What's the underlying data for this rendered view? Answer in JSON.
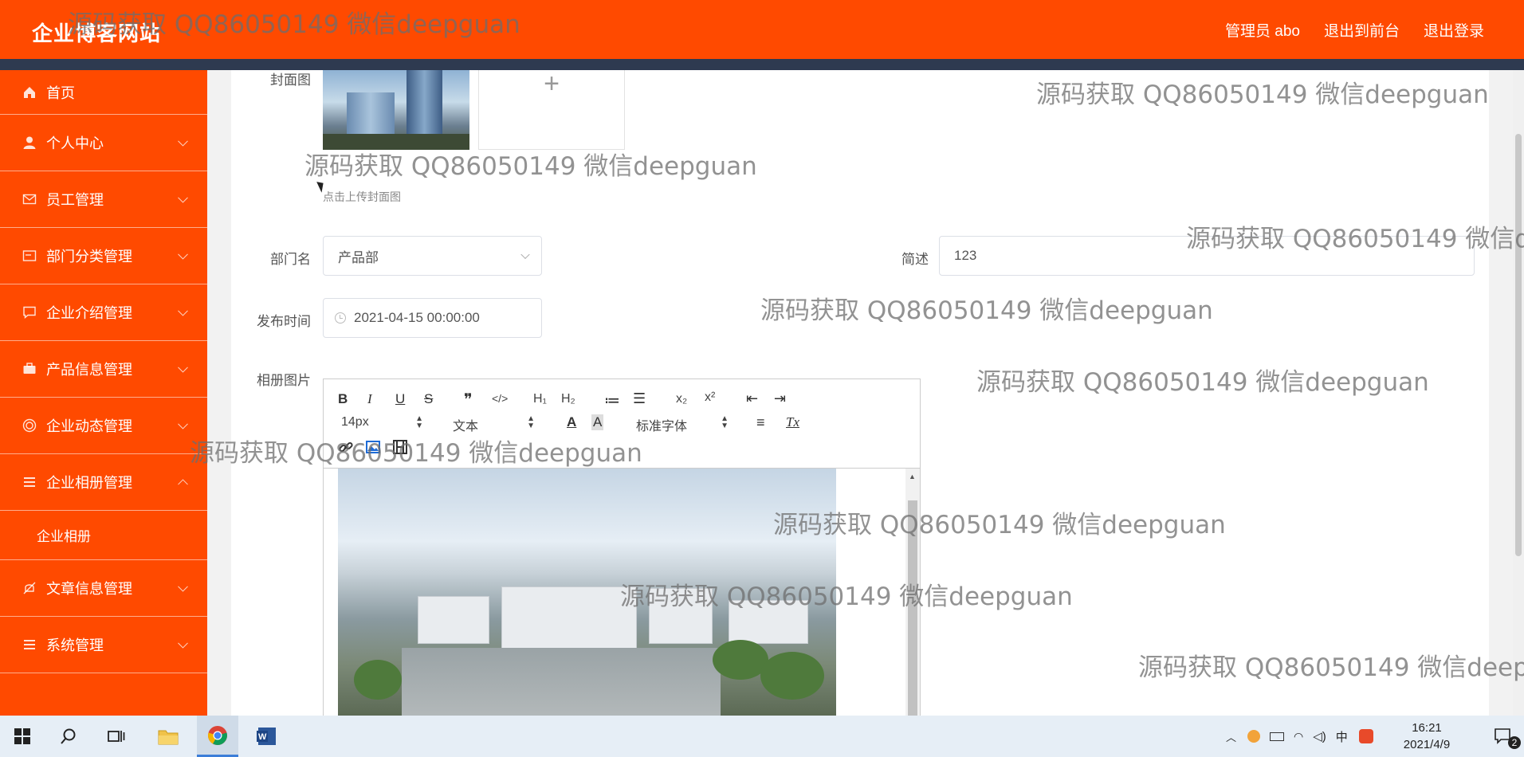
{
  "header": {
    "title": "企业博客网站",
    "links": [
      "管理员 abo",
      "退出到前台",
      "退出登录"
    ]
  },
  "sidebar": {
    "items": [
      {
        "label": "首页",
        "icon": "home-icon"
      },
      {
        "label": "个人中心",
        "icon": "user-icon"
      },
      {
        "label": "员工管理",
        "icon": "mail-icon"
      },
      {
        "label": "部门分类管理",
        "icon": "card-icon"
      },
      {
        "label": "企业介绍管理",
        "icon": "chat-icon"
      },
      {
        "label": "产品信息管理",
        "icon": "briefcase-icon"
      },
      {
        "label": "企业动态管理",
        "icon": "target-icon"
      },
      {
        "label": "企业相册管理",
        "icon": "menu-icon"
      },
      {
        "label": "文章信息管理",
        "icon": "bell-icon"
      },
      {
        "label": "系统管理",
        "icon": "menu-icon"
      }
    ],
    "subitem": "企业相册"
  },
  "form": {
    "cover_label": "封面图",
    "cover_hint": "点击上传封面图",
    "upload_plus": "+",
    "dept_label": "部门名",
    "dept_value": "产品部",
    "summary_label": "简述",
    "summary_value": "123",
    "time_label": "发布时间",
    "time_value": "2021-04-15 00:00:00",
    "album_label": "相册图片"
  },
  "editor": {
    "buttons": [
      "B",
      "I",
      "U",
      "S",
      "❞",
      "</>",
      "H₁",
      "H₂",
      "≔",
      "☰",
      "x₂",
      "x²",
      "⇤",
      "⇥",
      "≡",
      "Tx"
    ],
    "font_size": "14px",
    "format": "文本",
    "font_family": "标准字体"
  },
  "watermark": "源码获取 QQ86050149 微信deepguan",
  "taskbar": {
    "time": "16:21",
    "date": "2021/4/9",
    "ime": "中",
    "notifications": "2"
  },
  "colors": {
    "brand": "#ff4a00",
    "header_strip": "#2e3a50"
  }
}
